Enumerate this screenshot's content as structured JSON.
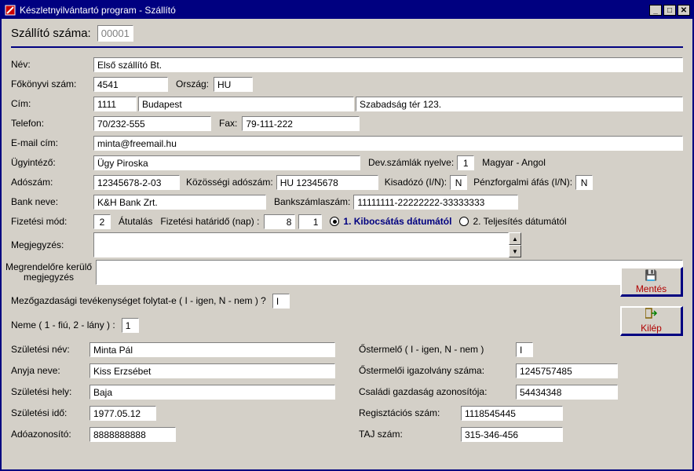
{
  "window": {
    "title": "Készletnyilvántartó program   -   Szállító"
  },
  "top": {
    "label": "Szállító száma:",
    "value": "00001"
  },
  "labels": {
    "nev": "Név:",
    "fokonyvi": "Főkönyvi szám:",
    "orszag": "Ország:",
    "cim": "Cím:",
    "telefon": "Telefon:",
    "fax": "Fax:",
    "email": "E-mail cím:",
    "ugyintezo": "Ügyintéző:",
    "devnyelv": "Dev.számlák nyelve:",
    "devnyelv_txt": "Magyar - Angol",
    "adoszam": "Adószám:",
    "kozossegi": "Közösségi adószám:",
    "kisadozo": "Kisadózó (I/N):",
    "penzforgalmi": "Pénzforgalmi áfás (I/N):",
    "bank": "Bank neve:",
    "bankszam": "Bankszámlaszám:",
    "fizmod": "Fizetési mód:",
    "atutalas": "Átutalás",
    "fizhatarido": "Fizetési határidő (nap) :",
    "radio1": "1. Kibocsátás dátumától",
    "radio2": "2. Teljesítés dátumától",
    "megj": "Megjegyzés:",
    "megrend_megj": "Megrendelőre kerülő megjegyzés",
    "mezogazd": "Mezőgazdasági tevékenységet folytat-e  ( I - igen,  N - nem ) ?",
    "neme": "Neme ( 1 - fiú,  2 - lány ) :",
    "szulnev": "Születési név:",
    "anyja": "Anyja neve:",
    "szulhely": "Születési hely:",
    "szulido": "Születési idő:",
    "adoazon": "Adóazonosító:",
    "ostermelo": "Őstermelő  ( I - igen,   N - nem )",
    "ostermeloi_ig": "Őstermelői igazolvány száma:",
    "csaladi": "Családi gazdaság azonosítója:",
    "regszam": "Regisztációs szám:",
    "taj": "TAJ szám:"
  },
  "values": {
    "nev": "Első szállító Bt.",
    "fokonyvi": "4541",
    "orszag": "HU",
    "irsz": "1111",
    "varos": "Budapest",
    "cim": "Szabadság tér 123.",
    "telefon": "70/232-555",
    "fax": "79-111-222",
    "email": "minta@freemail.hu",
    "ugyintezo": "Ügy Piroska",
    "devnyelv": "1",
    "adoszam": "12345678-2-03",
    "kozossegi": "HU 12345678",
    "kisadozo": "N",
    "penzforgalmi": "N",
    "bank": "K&H Bank Zrt.",
    "bankszam": "11111111-22222222-33333333",
    "fizmod": "2",
    "fizhatarido1": "8",
    "fizhatarido2": "1",
    "mezogazd": "I",
    "neme": "1",
    "szulnev": "Minta Pál",
    "anyja": "Kiss Erzsébet",
    "szulhely": "Baja",
    "szulido": "1977.05.12",
    "adoazon": "8888888888",
    "ostermelo": "I",
    "ostermeloi_ig": "1245757485",
    "csaladi": "54434348",
    "regszam": "1118545445",
    "taj": "315-346-456"
  },
  "buttons": {
    "mentes": "Mentés",
    "kilep": "Kilép"
  }
}
